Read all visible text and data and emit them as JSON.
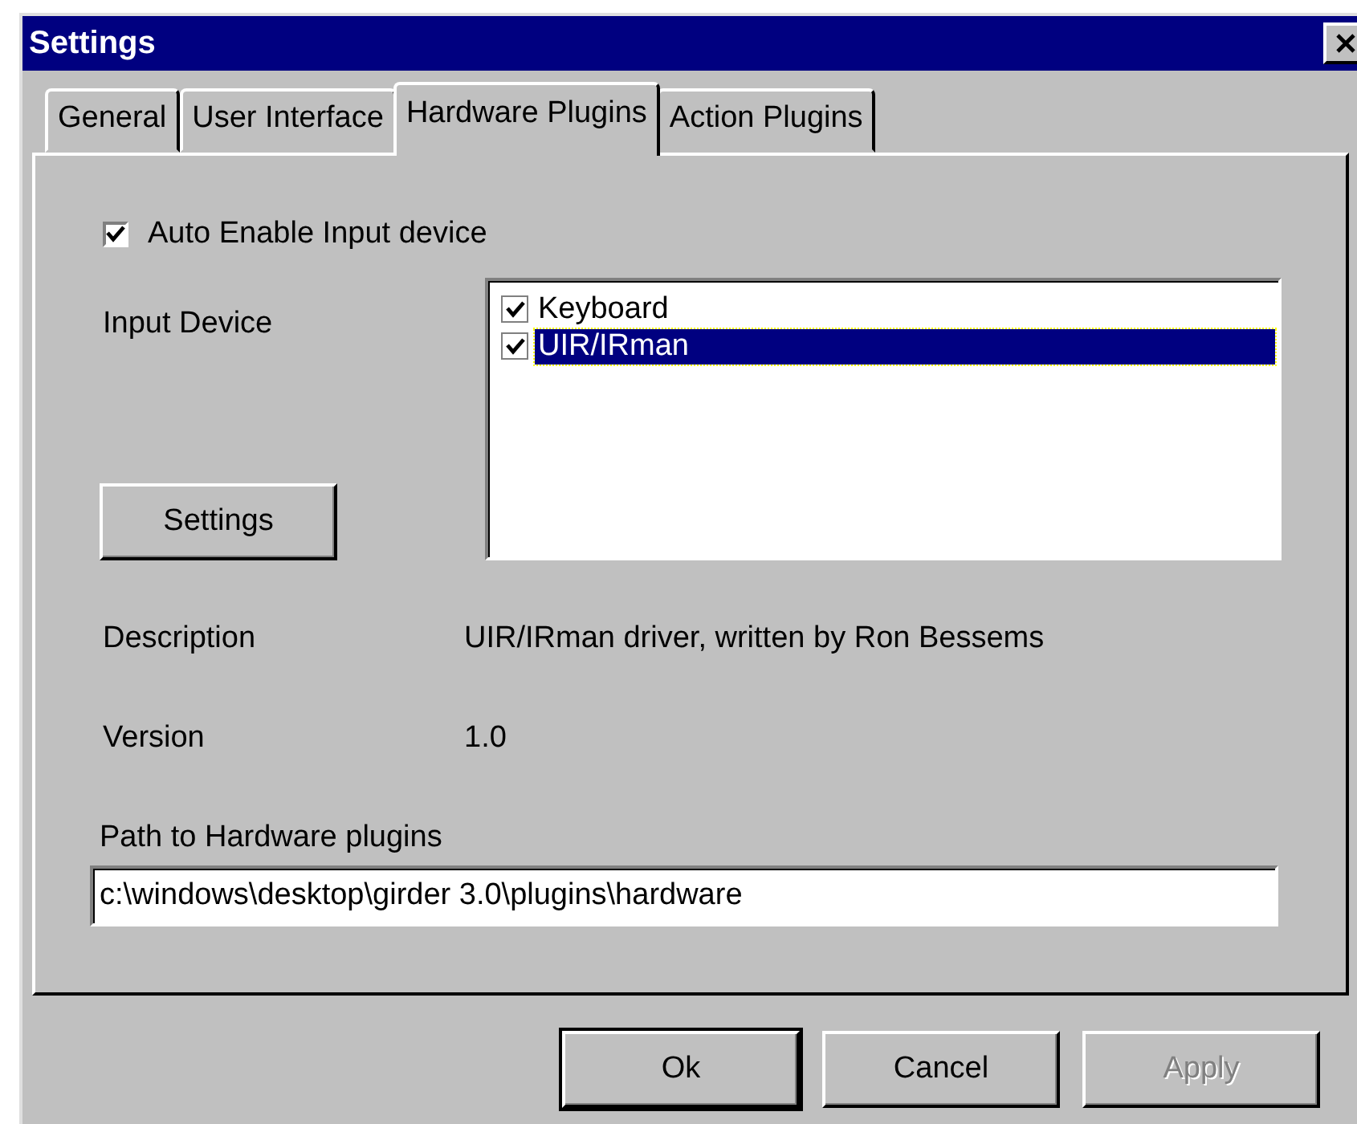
{
  "window": {
    "title": "Settings"
  },
  "tabs": [
    {
      "label": "General",
      "selected": false
    },
    {
      "label": "User Interface",
      "selected": false
    },
    {
      "label": "Hardware Plugins",
      "selected": true
    },
    {
      "label": "Action Plugins",
      "selected": false
    }
  ],
  "auto_enable": {
    "label": "Auto Enable Input device",
    "checked": true
  },
  "input_device": {
    "label": "Input Device",
    "items": [
      {
        "label": "Keyboard",
        "checked": true,
        "selected": false
      },
      {
        "label": "UIR/IRman",
        "checked": true,
        "selected": true
      }
    ]
  },
  "settings_button": {
    "label": "Settings"
  },
  "description": {
    "label": "Description",
    "value": "UIR/IRman driver, written by Ron Bessems"
  },
  "version": {
    "label": "Version",
    "value": "1.0"
  },
  "path": {
    "label": "Path to Hardware plugins",
    "value": "c:\\windows\\desktop\\girder 3.0\\plugins\\hardware"
  },
  "buttons": [
    {
      "label": "Ok",
      "default": true,
      "disabled": false
    },
    {
      "label": "Cancel",
      "default": false,
      "disabled": false
    },
    {
      "label": "Apply",
      "default": false,
      "disabled": true
    }
  ]
}
